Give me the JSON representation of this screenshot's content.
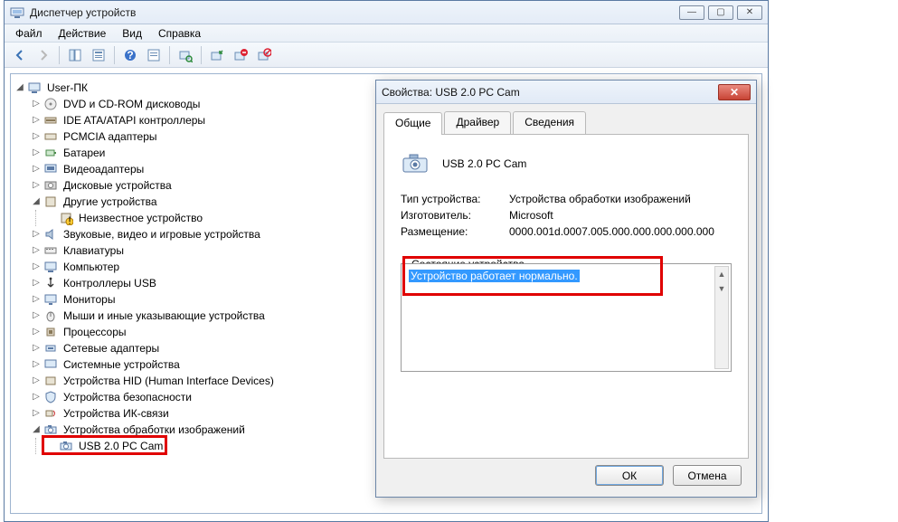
{
  "window": {
    "title": "Диспетчер устройств",
    "menus": {
      "file": "Файл",
      "action": "Действие",
      "view": "Вид",
      "help": "Справка"
    }
  },
  "tree": {
    "root": "User-ПК",
    "items": [
      "DVD и CD-ROM дисководы",
      "IDE ATA/ATAPI контроллеры",
      "PCMCIA адаптеры",
      "Батареи",
      "Видеоадаптеры",
      "Дисковые устройства",
      "Другие устройства",
      "Неизвестное устройство",
      "Звуковые, видео и игровые устройства",
      "Клавиатуры",
      "Компьютер",
      "Контроллеры USB",
      "Мониторы",
      "Мыши и иные указывающие устройства",
      "Процессоры",
      "Сетевые адаптеры",
      "Системные устройства",
      "Устройства HID (Human Interface Devices)",
      "Устройства безопасности",
      "Устройства ИК-связи",
      "Устройства обработки изображений",
      "USB 2.0 PC Cam"
    ]
  },
  "props": {
    "title": "Свойства: USB 2.0 PC Cam",
    "tabs": {
      "general": "Общие",
      "driver": "Драйвер",
      "details": "Сведения"
    },
    "device_name": "USB 2.0 PC Cam",
    "rows": {
      "type_k": "Тип устройства:",
      "type_v": "Устройства обработки изображений",
      "mfg_k": "Изготовитель:",
      "mfg_v": "Microsoft",
      "loc_k": "Размещение:",
      "loc_v": "0000.001d.0007.005.000.000.000.000.000"
    },
    "status_label": "Состояние устройства",
    "status_text": "Устройство работает нормально.",
    "ok": "ОК",
    "cancel": "Отмена"
  }
}
